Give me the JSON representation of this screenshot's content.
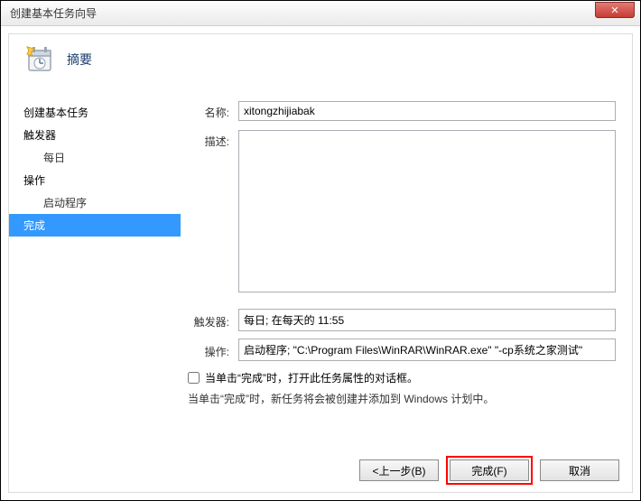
{
  "window": {
    "title": "创建基本任务向导"
  },
  "header": {
    "heading": "摘要"
  },
  "sidebar": {
    "items": [
      {
        "label": "创建基本任务",
        "indent": false,
        "selected": false
      },
      {
        "label": "触发器",
        "indent": false,
        "selected": false
      },
      {
        "label": "每日",
        "indent": true,
        "selected": false
      },
      {
        "label": "操作",
        "indent": false,
        "selected": false
      },
      {
        "label": "启动程序",
        "indent": true,
        "selected": false
      },
      {
        "label": "完成",
        "indent": false,
        "selected": true
      }
    ]
  },
  "form": {
    "name_label": "名称:",
    "name_value": "xitongzhijiabak",
    "desc_label": "描述:",
    "desc_value": "",
    "trigger_label": "触发器:",
    "trigger_value": "每日; 在每天的 11:55",
    "action_label": "操作:",
    "action_value": "启动程序; \"C:\\Program Files\\WinRAR\\WinRAR.exe\" \"-cp系统之家测试\"",
    "checkbox_label": "当单击“完成”时，打开此任务属性的对话框。",
    "note": "当单击“完成”时，新任务将会被创建并添加到 Windows 计划中。"
  },
  "footer": {
    "back": "<上一步(B)",
    "finish": "完成(F)",
    "cancel": "取消"
  },
  "icons": {
    "close": "✕"
  }
}
